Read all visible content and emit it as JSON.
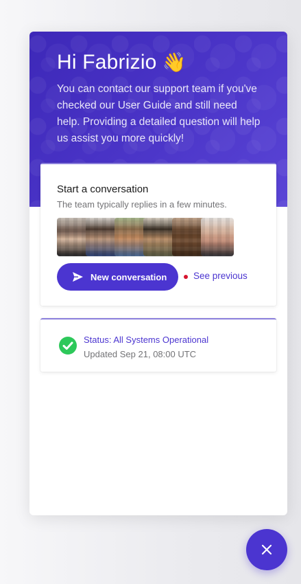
{
  "header": {
    "greeting": "Hi Fabrizio",
    "greeting_emoji": "👋",
    "intro": "You can contact our support team if you've checked our User Guide and still need help. Providing a detailed question will help us assist you more quickly!"
  },
  "conversation_card": {
    "title": "Start a conversation",
    "subtitle": "The team typically replies in a few minutes.",
    "avatars": [
      "team-member-1",
      "team-member-2",
      "team-member-3",
      "team-member-4",
      "team-member-5",
      "team-member-6"
    ],
    "new_button_label": "New conversation",
    "see_previous_label": "See previous"
  },
  "status_card": {
    "title": "Status: All Systems Operational",
    "updated": "Updated Sep 21, 08:00 UTC"
  },
  "colors": {
    "brand": "#4b35d0",
    "header_bg": "#3d28b8",
    "status_ok": "#2dc85a",
    "unread_dot": "#d6152f"
  },
  "icons": {
    "send": "send-icon",
    "status": "check-circle-icon",
    "close": "close-icon"
  }
}
